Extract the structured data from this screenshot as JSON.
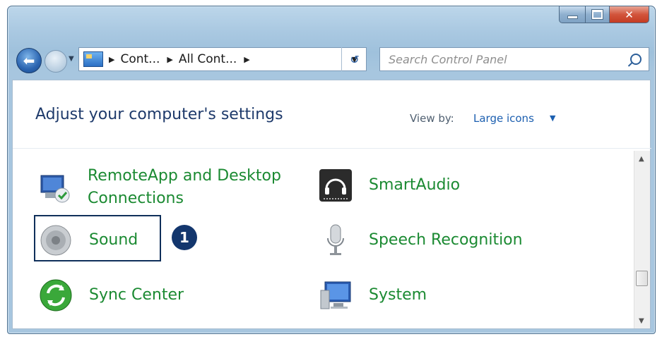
{
  "address": {
    "crumbs": [
      "Cont...",
      "All Cont..."
    ]
  },
  "search": {
    "placeholder": "Search Control Panel"
  },
  "header": {
    "title": "Adjust your computer's settings",
    "view_by_label": "View by:",
    "view_by_value": "Large icons"
  },
  "items": [
    {
      "label_line1": "RemoteApp and Desktop",
      "label_line2": "Connections",
      "icon": "remoteapp-icon"
    },
    {
      "label": "SmartAudio",
      "icon": "smartaudio-icon"
    },
    {
      "label": "Sound",
      "icon": "speaker-icon"
    },
    {
      "label": "Speech Recognition",
      "icon": "microphone-icon"
    },
    {
      "label": "Sync Center",
      "icon": "sync-icon"
    },
    {
      "label": "System",
      "icon": "computer-icon"
    }
  ],
  "callout": {
    "number": "1"
  },
  "colors": {
    "item_text": "#1b8a32",
    "title_text": "#1e3a6b",
    "link_blue": "#1c5fb0",
    "callout_bg": "#13366d",
    "close_button": "#c43b22"
  }
}
